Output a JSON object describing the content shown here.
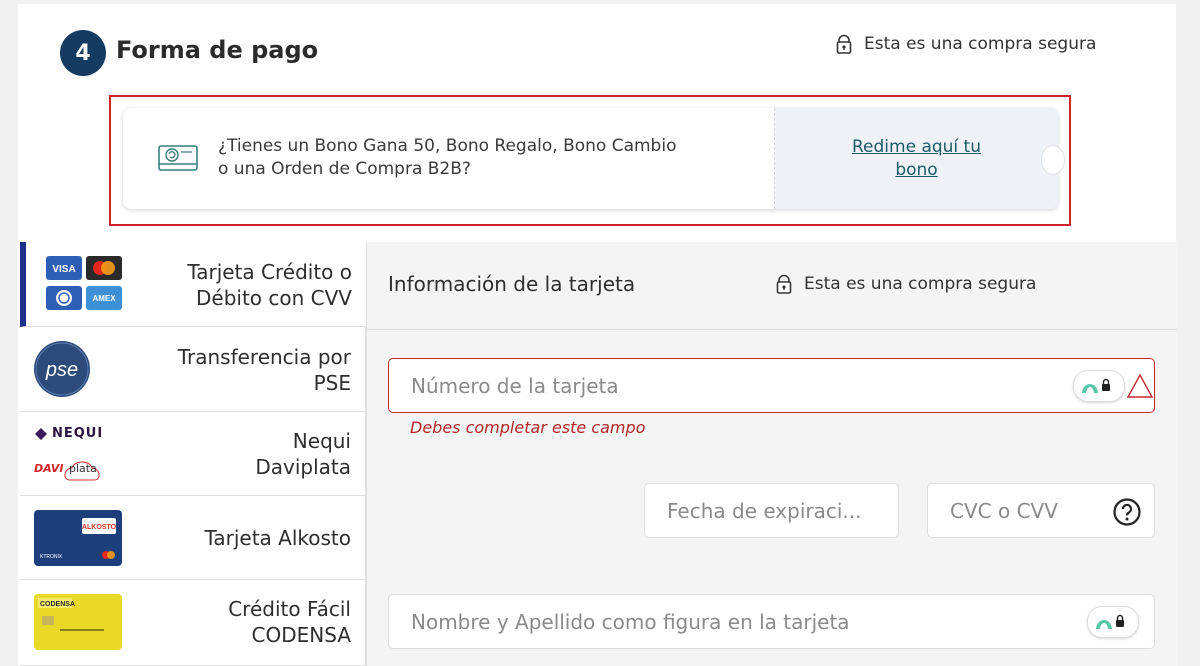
{
  "header": {
    "step_number": "4",
    "title": "Forma de pago",
    "secure_text": "Esta es una compra segura"
  },
  "voucher": {
    "text": "¿Tienes un Bono Gana 50, Bono Regalo, Bono Cambio o una Orden de Compra B2B?",
    "redeem_line1": "Redime aquí tu",
    "redeem_line2": "bono",
    "icon": "voucher-card-icon"
  },
  "payment_methods": [
    {
      "line1": "Tarjeta Crédito o",
      "line2": "Débito con CVV",
      "logos": [
        "VISA",
        "Mastercard",
        "Diners",
        "AMEX"
      ],
      "active": true
    },
    {
      "line1": "Transferencia por",
      "line2": "PSE",
      "logos": [
        "pse"
      ]
    },
    {
      "line1": "Nequi",
      "line2": "Daviplata",
      "logos": [
        "NEQUI",
        "DAVIplata"
      ]
    },
    {
      "line1": "Tarjeta Alkosto",
      "line2": "",
      "logos": [
        "ALKOSTO",
        "KTRONIX"
      ]
    },
    {
      "line1": "Crédito Fácil",
      "line2": "CODENSA",
      "logos": [
        "CODENSA"
      ]
    }
  ],
  "logo_text": {
    "visa": "VISA",
    "amex": "AMEX",
    "pse": "pse",
    "nequi": "NEQUI",
    "davi": "DAVI",
    "plata": "plata",
    "alkosto": "ALKOSTO",
    "ktronix": "KTRONIX",
    "codensa": "CODENSA"
  },
  "card_form": {
    "title": "Información de la tarjeta",
    "secure_text": "Esta es una compra segura",
    "number_placeholder": "Número de la tarjeta",
    "number_error": "Debes completar este campo",
    "expiry_placeholder": "Fecha de expiraci...",
    "cvc_placeholder": "CVC o CVV",
    "name_placeholder": "Nombre y Apellido como figura en la tarjeta"
  },
  "colors": {
    "step_circle": "#163b63",
    "error": "#c52b32",
    "active_method_bar": "#1f2f8a",
    "link": "#1c5b68",
    "redeem_bg": "#eef1f6"
  }
}
